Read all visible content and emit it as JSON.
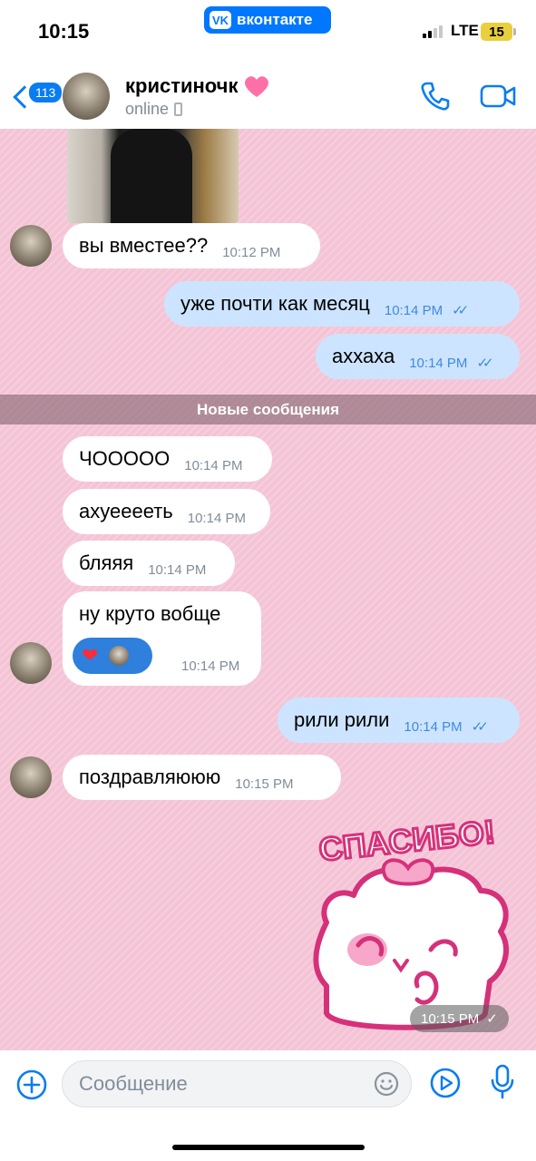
{
  "status_bar": {
    "time": "10:15",
    "app_pill": "вконтакте",
    "network": "LTE",
    "battery": "15"
  },
  "header": {
    "back_badge": "113",
    "name": "кристиночк",
    "status": "online",
    "icons": [
      "back-chevron-icon",
      "heart-icon",
      "phone-icon",
      "video-icon"
    ]
  },
  "chat": {
    "divider": "Новые сообщения",
    "messages": [
      {
        "dir": "in",
        "text": "вы вместее??",
        "time": "10:12 PM"
      },
      {
        "dir": "out",
        "text": "уже почти как месяц",
        "time": "10:14 PM"
      },
      {
        "dir": "out",
        "text": "аххаха",
        "time": "10:14 PM"
      },
      {
        "dir": "in",
        "text": "ЧООООО",
        "time": "10:14 PM"
      },
      {
        "dir": "in",
        "text": "ахуееееть",
        "time": "10:14 PM"
      },
      {
        "dir": "in",
        "text": "бляяя",
        "time": "10:14 PM"
      },
      {
        "dir": "in",
        "text": "ну круто вобще",
        "time": "10:14 PM"
      },
      {
        "dir": "out",
        "text": "рили рили",
        "time": "10:14 PM"
      },
      {
        "dir": "in",
        "text": "поздравляююю",
        "time": "10:15 PM"
      }
    ],
    "sticker": {
      "text": "СПАСИБО!",
      "time": "10:15 PM"
    }
  },
  "composer": {
    "placeholder": "Сообщение"
  },
  "colors": {
    "accent": "#0a7cf2",
    "chat_bg": "#f4c4d6",
    "out_bubble": "#cce4ff",
    "in_bubble": "#ffffff"
  }
}
